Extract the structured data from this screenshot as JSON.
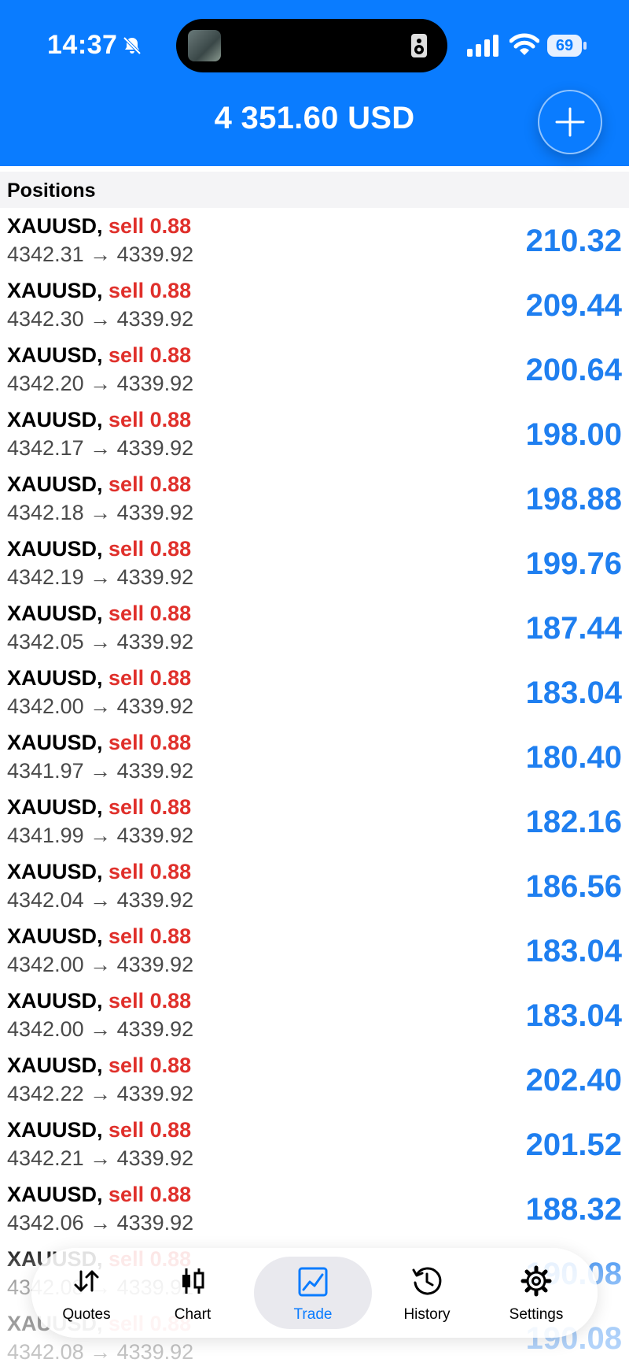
{
  "status_bar": {
    "time": "14:37",
    "battery": "69"
  },
  "header": {
    "balance": "4 351.60 USD"
  },
  "section": {
    "title": "Positions"
  },
  "positions": [
    {
      "symbol": "XAUUSD,",
      "side": "sell 0.88",
      "prices": "4342.31 → 4339.92",
      "profit": "210.32"
    },
    {
      "symbol": "XAUUSD,",
      "side": "sell 0.88",
      "prices": "4342.30 → 4339.92",
      "profit": "209.44"
    },
    {
      "symbol": "XAUUSD,",
      "side": "sell 0.88",
      "prices": "4342.20 → 4339.92",
      "profit": "200.64"
    },
    {
      "symbol": "XAUUSD,",
      "side": "sell 0.88",
      "prices": "4342.17 → 4339.92",
      "profit": "198.00"
    },
    {
      "symbol": "XAUUSD,",
      "side": "sell 0.88",
      "prices": "4342.18 → 4339.92",
      "profit": "198.88"
    },
    {
      "symbol": "XAUUSD,",
      "side": "sell 0.88",
      "prices": "4342.19 → 4339.92",
      "profit": "199.76"
    },
    {
      "symbol": "XAUUSD,",
      "side": "sell 0.88",
      "prices": "4342.05 → 4339.92",
      "profit": "187.44"
    },
    {
      "symbol": "XAUUSD,",
      "side": "sell 0.88",
      "prices": "4342.00 → 4339.92",
      "profit": "183.04"
    },
    {
      "symbol": "XAUUSD,",
      "side": "sell 0.88",
      "prices": "4341.97 → 4339.92",
      "profit": "180.40"
    },
    {
      "symbol": "XAUUSD,",
      "side": "sell 0.88",
      "prices": "4341.99 → 4339.92",
      "profit": "182.16"
    },
    {
      "symbol": "XAUUSD,",
      "side": "sell 0.88",
      "prices": "4342.04 → 4339.92",
      "profit": "186.56"
    },
    {
      "symbol": "XAUUSD,",
      "side": "sell 0.88",
      "prices": "4342.00 → 4339.92",
      "profit": "183.04"
    },
    {
      "symbol": "XAUUSD,",
      "side": "sell 0.88",
      "prices": "4342.00 → 4339.92",
      "profit": "183.04"
    },
    {
      "symbol": "XAUUSD,",
      "side": "sell 0.88",
      "prices": "4342.22 → 4339.92",
      "profit": "202.40"
    },
    {
      "symbol": "XAUUSD,",
      "side": "sell 0.88",
      "prices": "4342.21 → 4339.92",
      "profit": "201.52"
    },
    {
      "symbol": "XAUUSD,",
      "side": "sell 0.88",
      "prices": "4342.06 → 4339.92",
      "profit": "188.32"
    },
    {
      "symbol": "XAUUSD,",
      "side": "sell 0.88",
      "prices": "4342.08 → 4339.92",
      "profit": "190.08"
    },
    {
      "symbol": "XAUUSD,",
      "side": "sell 0.88",
      "prices": "4342.08 → 4339.92",
      "profit": "190.08"
    }
  ],
  "tabbar": {
    "tabs": [
      {
        "label": "Quotes",
        "icon": "quotes-arrows-icon"
      },
      {
        "label": "Chart",
        "icon": "candlestick-icon"
      },
      {
        "label": "Trade",
        "icon": "trade-chart-icon",
        "active": true
      },
      {
        "label": "History",
        "icon": "history-clock-icon"
      },
      {
        "label": "Settings",
        "icon": "gear-icon"
      }
    ]
  },
  "colors": {
    "accent": "#0a7cff",
    "sell": "#e0302b",
    "profit": "#1f7ff0"
  }
}
